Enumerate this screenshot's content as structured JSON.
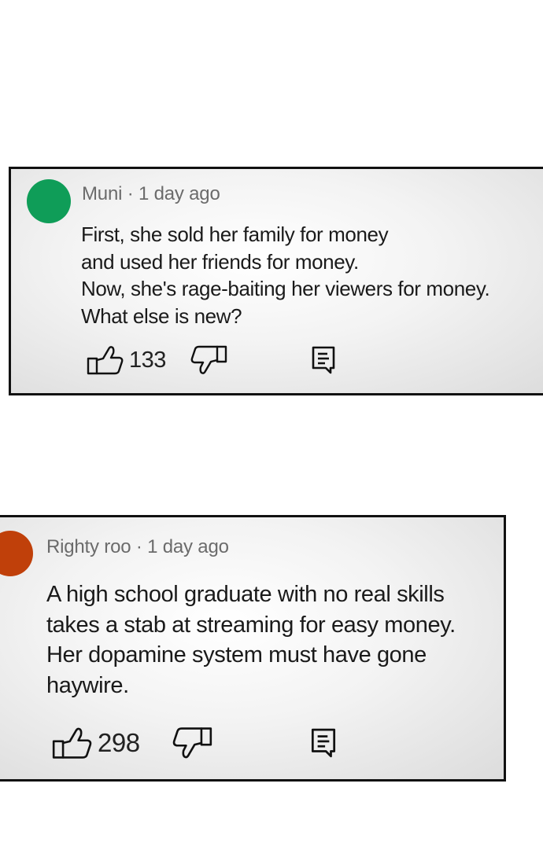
{
  "comments": [
    {
      "author": "Muni",
      "separator": "·",
      "time": "1 day ago",
      "avatar_color": "#0f9d58",
      "lines": [
        "First, she sold her family for money",
        "and used her friends for money.",
        "Now, she's rage-baiting her viewers for money.",
        "What else is new?"
      ],
      "likes": "133",
      "icons": {
        "like": "thumbs-up-icon",
        "dislike": "thumbs-down-icon",
        "reply": "reply-icon"
      }
    },
    {
      "author": "Righty roo",
      "separator": "·",
      "time": "1 day ago",
      "avatar_color": "#c0400a",
      "lines": [
        "A high school graduate with no real skills",
        "takes a stab at streaming for easy money.",
        "Her dopamine system must have gone",
        "haywire."
      ],
      "likes": "298",
      "icons": {
        "like": "thumbs-up-icon",
        "dislike": "thumbs-down-icon",
        "reply": "reply-icon"
      }
    }
  ]
}
